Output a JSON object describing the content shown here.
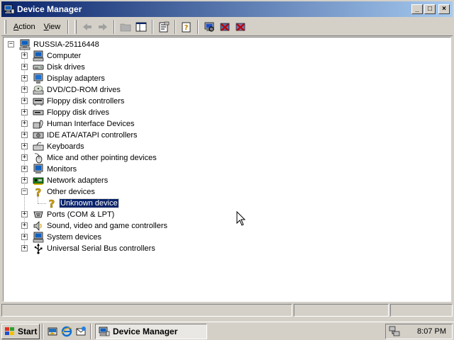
{
  "window": {
    "title": "Device Manager"
  },
  "caption_buttons": {
    "minimize": "_",
    "maximize": "□",
    "close": "×"
  },
  "menu": {
    "action": {
      "accel": "A",
      "rest": "ction"
    },
    "view": {
      "accel": "V",
      "rest": "iew"
    }
  },
  "toolbar": {
    "buttons": [
      "back",
      "forward",
      "up-folder",
      "show-hide-tree",
      "properties",
      "help",
      "scan-hardware",
      "uninstall",
      "disable"
    ]
  },
  "tree": {
    "root": "RUSSIA-25116448",
    "categories": [
      {
        "label": "Computer",
        "icon": "computer-icon",
        "expanded": false
      },
      {
        "label": "Disk drives",
        "icon": "disk-drive-icon",
        "expanded": false
      },
      {
        "label": "Display adapters",
        "icon": "display-adapter-icon",
        "expanded": false
      },
      {
        "label": "DVD/CD-ROM drives",
        "icon": "cdrom-icon",
        "expanded": false
      },
      {
        "label": "Floppy disk controllers",
        "icon": "floppy-controller-icon",
        "expanded": false
      },
      {
        "label": "Floppy disk drives",
        "icon": "floppy-drive-icon",
        "expanded": false
      },
      {
        "label": "Human Interface Devices",
        "icon": "hid-icon",
        "expanded": false
      },
      {
        "label": "IDE ATA/ATAPI controllers",
        "icon": "ide-controller-icon",
        "expanded": false
      },
      {
        "label": "Keyboards",
        "icon": "keyboard-icon",
        "expanded": false
      },
      {
        "label": "Mice and other pointing devices",
        "icon": "mouse-icon",
        "expanded": false
      },
      {
        "label": "Monitors",
        "icon": "monitor-icon",
        "expanded": false
      },
      {
        "label": "Network adapters",
        "icon": "network-adapter-icon",
        "expanded": false
      },
      {
        "label": "Other devices",
        "icon": "question-mark-icon",
        "expanded": true,
        "children": [
          "Unknown device"
        ]
      },
      {
        "label": "Ports (COM & LPT)",
        "icon": "port-icon",
        "expanded": false
      },
      {
        "label": "Sound, video and game controllers",
        "icon": "speaker-icon",
        "expanded": false
      },
      {
        "label": "System devices",
        "icon": "system-device-icon",
        "expanded": false
      },
      {
        "label": "Universal Serial Bus controllers",
        "icon": "usb-icon",
        "expanded": false
      }
    ],
    "selected": "Unknown device"
  },
  "taskbar": {
    "start_label": "Start",
    "task_label": "Device Manager",
    "clock": "8:07 PM"
  },
  "colors": {
    "titlebar_start": "#0a246a",
    "titlebar_end": "#a6caf0",
    "selection": "#0a246a",
    "face": "#d4d0c8"
  }
}
